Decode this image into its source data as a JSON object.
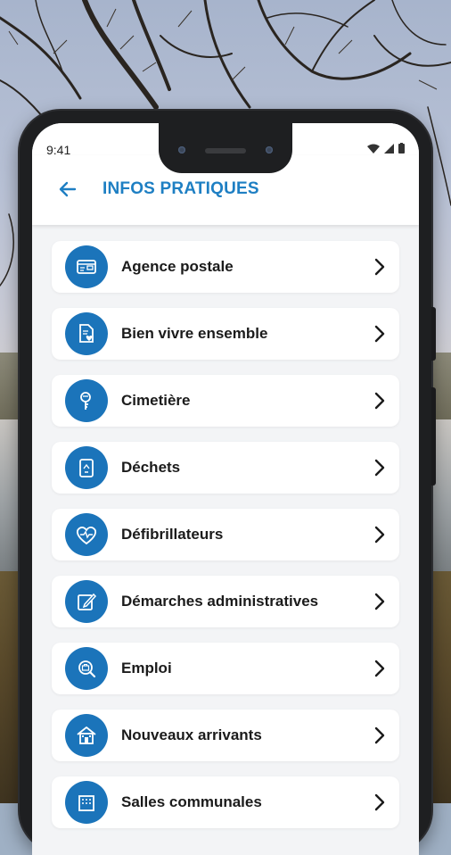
{
  "status_bar": {
    "time": "9:41"
  },
  "header": {
    "title": "INFOS PRATIQUES"
  },
  "menu": {
    "items": [
      {
        "label": "Agence postale",
        "icon": "post-office-icon"
      },
      {
        "label": "Bien vivre ensemble",
        "icon": "document-heart-icon"
      },
      {
        "label": "Cimetière",
        "icon": "cemetery-icon"
      },
      {
        "label": "Déchets",
        "icon": "recycle-bin-icon"
      },
      {
        "label": "Défibrillateurs",
        "icon": "heart-pulse-icon"
      },
      {
        "label": "Démarches administratives",
        "icon": "edit-form-icon"
      },
      {
        "label": "Emploi",
        "icon": "job-search-icon"
      },
      {
        "label": "Nouveaux arrivants",
        "icon": "house-icon"
      },
      {
        "label": "Salles communales",
        "icon": "building-icon"
      }
    ]
  },
  "colors": {
    "accent": "#1e7fc3",
    "icon_circle": "#1b74ba"
  }
}
